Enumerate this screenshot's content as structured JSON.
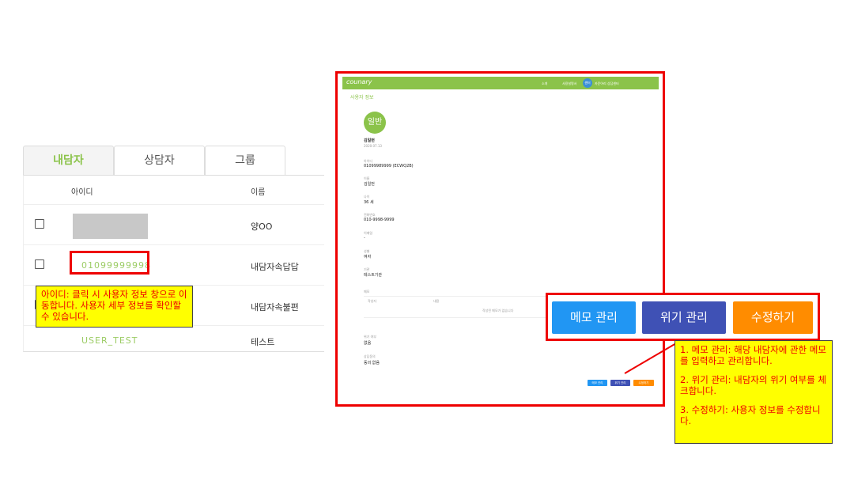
{
  "tabs": [
    {
      "label": "내담자"
    },
    {
      "label": "상담자"
    },
    {
      "label": "그룹"
    }
  ],
  "list": {
    "headers": {
      "id": "아이디",
      "name": "이름"
    },
    "rows": [
      {
        "id": "",
        "name": "양OO"
      },
      {
        "id": "01099999998",
        "name": "내담자속답답"
      },
      {
        "id": "",
        "name": "내담자속불편"
      },
      {
        "id": "USER_TEST",
        "name": "테스트"
      }
    ]
  },
  "callout_id": {
    "text": "아이디: 클릭 시 사용자 정보 창으로 이동합니다. 사용자 세부 정보를 확인할 수 있습니다."
  },
  "detail": {
    "logo": "counary",
    "nav": [
      "소개",
      "사용설명서"
    ],
    "user_chip": "센터",
    "center_name": "카운어리 상담센터",
    "section_title": "사용자 정보",
    "avatar": "일반",
    "name": "김일번",
    "sub": "2020.07.13",
    "fields": [
      {
        "label": "아이디",
        "value": "01099989999 (ECWQ2B)"
      },
      {
        "label": "이름",
        "value": "김일번"
      },
      {
        "label": "나이",
        "value": "36 세"
      },
      {
        "label": "전화번호",
        "value": "010-9998-9999"
      },
      {
        "label": "이메일",
        "value": "-"
      },
      {
        "label": "성별",
        "value": "여자"
      },
      {
        "label": "기관",
        "value": "테스트기관"
      }
    ],
    "memo_label": "메모",
    "memo_cols": [
      "작성자",
      "내용"
    ],
    "memo_empty": "작성된 메모가 없습니다",
    "crisis_label": "위기 여부",
    "crisis_value": "없음",
    "consent_label": "상담동의",
    "consent_value": "동의 없음",
    "mini_buttons": [
      "메모 관리",
      "위기 관리",
      "수정하기"
    ]
  },
  "buttons": {
    "memo": "메모 관리",
    "crisis": "위기 관리",
    "edit": "수정하기"
  },
  "colors": {
    "brand_green": "#8bc34a",
    "memo_blue": "#2196f3",
    "crisis_indigo": "#3f51b5",
    "edit_orange": "#ff8c00",
    "highlight_red": "#e00000",
    "callout_yellow": "#ffff00"
  },
  "callout_buttons": {
    "line1": "1. 메모 관리: 해당 내담자에 관한 메모를 입력하고 관리합니다.",
    "line2": "2. 위기 관리: 내담자의 위기 여부를 체크합니다.",
    "line3": "3. 수정하기: 사용자 정보를 수정합니다."
  }
}
